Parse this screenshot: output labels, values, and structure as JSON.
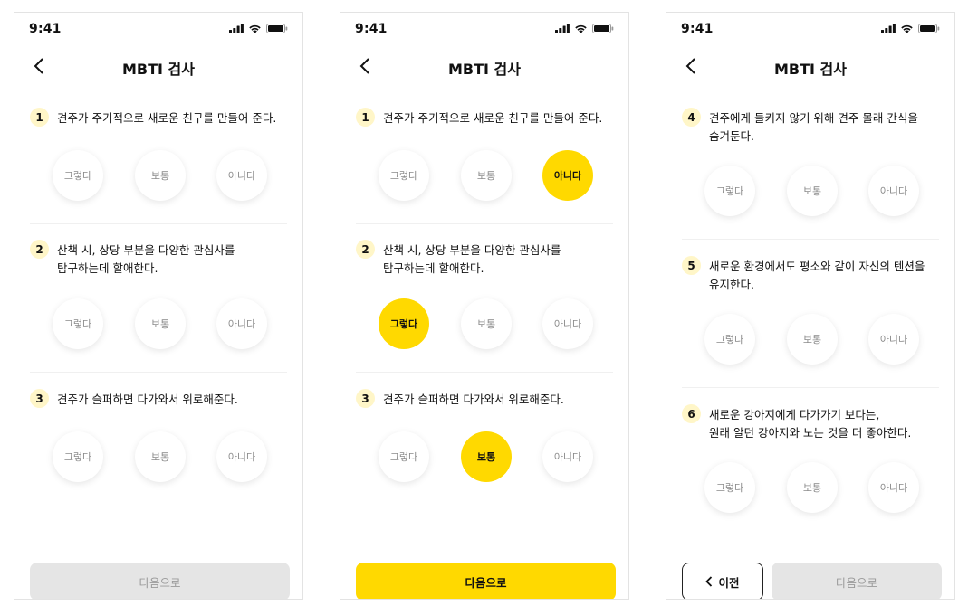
{
  "screens": [
    {
      "time": "9:41",
      "title": "MBTI 검사",
      "questions": [
        {
          "num": "1",
          "lines": [
            "견주가 주기적으로 새로운 친구를 만들어 준다."
          ],
          "options": [
            "그렇다",
            "보통",
            "아니다"
          ],
          "selected": null
        },
        {
          "num": "2",
          "lines": [
            "산책 시, 상당 부분을 다양한 관심사를",
            "탐구하는데 할애한다."
          ],
          "options": [
            "그렇다",
            "보통",
            "아니다"
          ],
          "selected": null
        },
        {
          "num": "3",
          "lines": [
            "견주가 슬퍼하면 다가와서 위로해준다."
          ],
          "options": [
            "그렇다",
            "보통",
            "아니다"
          ],
          "selected": null
        }
      ],
      "next_label": "다음으로",
      "next_enabled": false
    },
    {
      "time": "9:41",
      "title": "MBTI 검사",
      "questions": [
        {
          "num": "1",
          "lines": [
            "견주가 주기적으로 새로운 친구를 만들어 준다."
          ],
          "options": [
            "그렇다",
            "보통",
            "아니다"
          ],
          "selected": 2
        },
        {
          "num": "2",
          "lines": [
            "산책 시, 상당 부분을 다양한 관심사를",
            "탐구하는데 할애한다."
          ],
          "options": [
            "그렇다",
            "보통",
            "아니다"
          ],
          "selected": 0
        },
        {
          "num": "3",
          "lines": [
            "견주가 슬퍼하면 다가와서 위로해준다."
          ],
          "options": [
            "그렇다",
            "보통",
            "아니다"
          ],
          "selected": 1
        }
      ],
      "next_label": "다음으로",
      "next_enabled": true
    },
    {
      "time": "9:41",
      "title": "MBTI 검사",
      "questions": [
        {
          "num": "4",
          "lines": [
            "견주에게 들키지 않기 위해 견주 몰래 간식을",
            "숨겨둔다."
          ],
          "options": [
            "그렇다",
            "보통",
            "아니다"
          ],
          "selected": null
        },
        {
          "num": "5",
          "lines": [
            "새로운 환경에서도 평소와 같이 자신의 텐션을",
            "유지한다."
          ],
          "options": [
            "그렇다",
            "보통",
            "아니다"
          ],
          "selected": null
        },
        {
          "num": "6",
          "lines": [
            "새로운 강아지에게 다가가기 보다는,",
            "원래 알던 강아지와 노는 것을 더 좋아한다."
          ],
          "options": [
            "그렇다",
            "보통",
            "아니다"
          ],
          "selected": null
        }
      ],
      "prev_label": "이전",
      "next_label": "다음으로",
      "next_enabled": false
    }
  ],
  "colors": {
    "accent": "#ffd900",
    "number_badge": "#fff6c8",
    "disabled": "#e5e5e5"
  }
}
